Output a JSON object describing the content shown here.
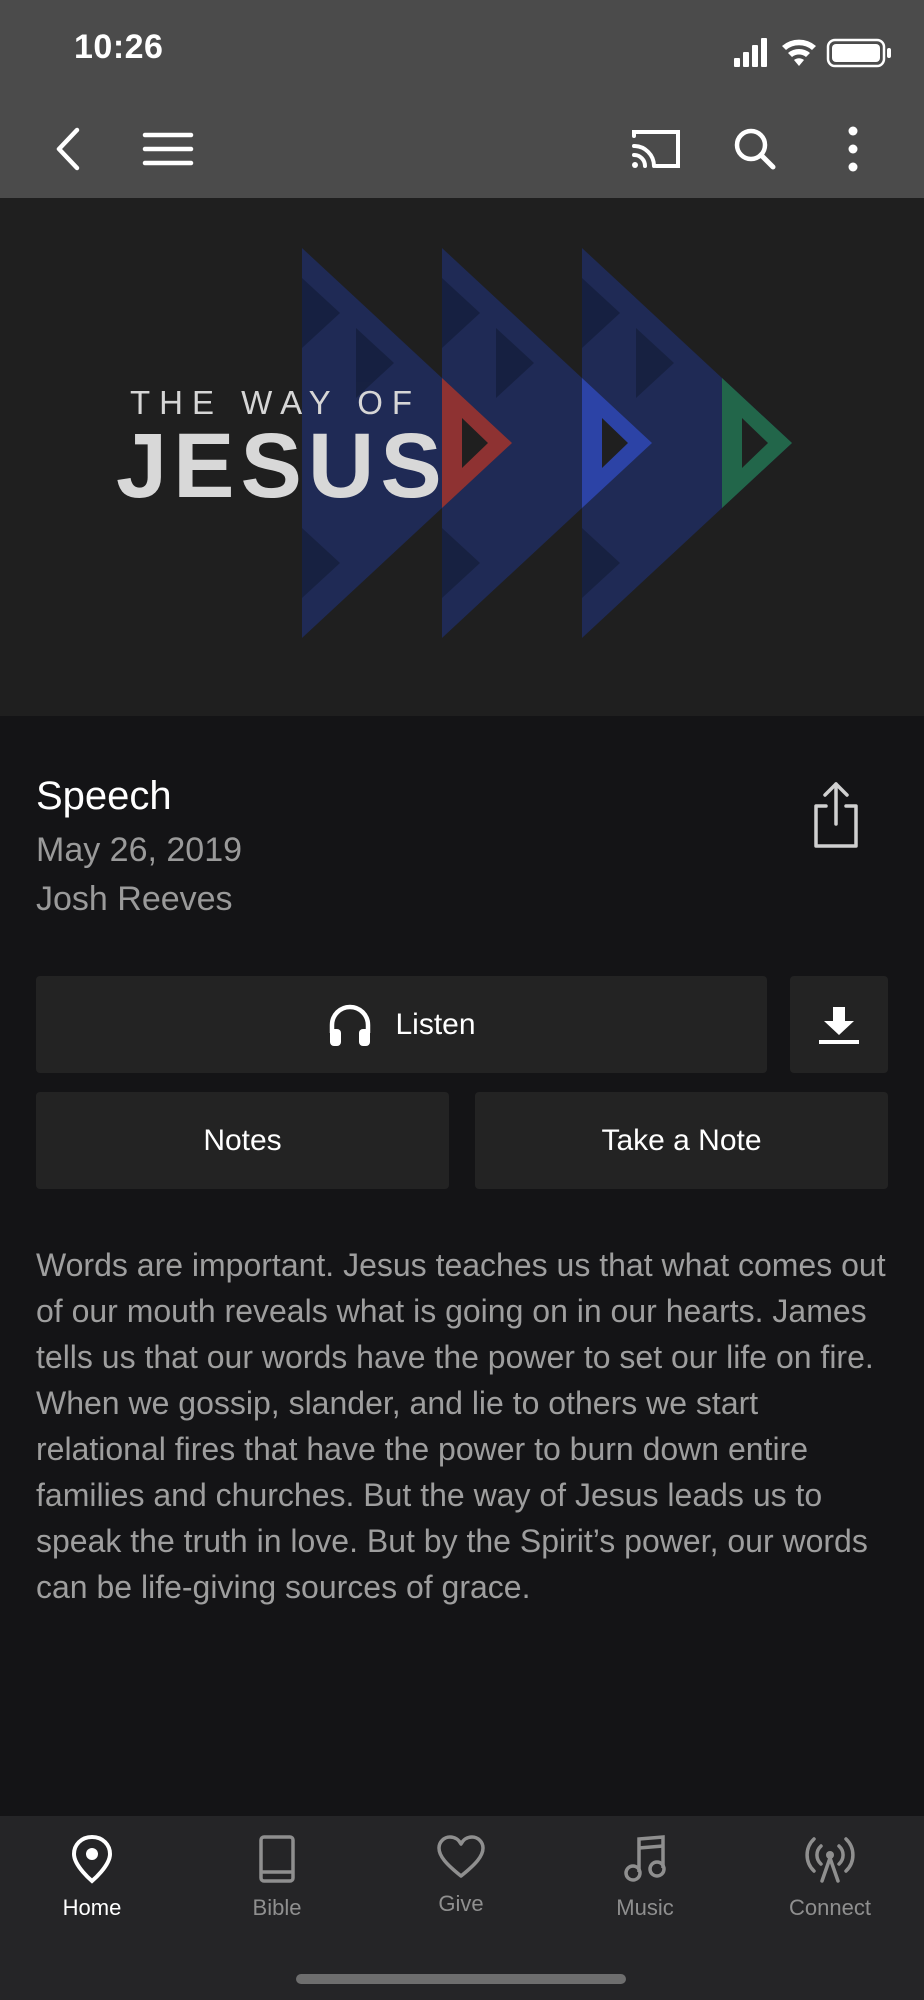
{
  "status": {
    "time": "10:26"
  },
  "hero": {
    "subtitle": "THE WAY OF",
    "title": "JESUS"
  },
  "sermon": {
    "title": "Speech",
    "date": "May 26, 2019",
    "speaker": "Josh Reeves",
    "description": "Words are important. Jesus teaches us that what comes out of our mouth reveals what is going on in our hearts. James tells us that our words have the power to set our life on fire. When we gossip, slander, and lie to others we start relational fires that have the power to burn down entire families and churches. But the way of Jesus leads us to speak the truth in love. But by the Spirit’s power, our words can be life-giving sources of grace."
  },
  "actions": {
    "listen": "Listen",
    "notes": "Notes",
    "take_note": "Take a Note"
  },
  "tabs": [
    {
      "label": "Home",
      "icon": "location-pin-icon",
      "active": true
    },
    {
      "label": "Bible",
      "icon": "book-icon"
    },
    {
      "label": "Give",
      "icon": "heart-icon"
    },
    {
      "label": "Music",
      "icon": "music-note-icon"
    },
    {
      "label": "Connect",
      "icon": "broadcast-icon"
    }
  ],
  "colors": {
    "nav_bg": "#4b4b4b",
    "background": "#141416",
    "button_bg": "#232323",
    "tabbar_bg": "#252527"
  }
}
